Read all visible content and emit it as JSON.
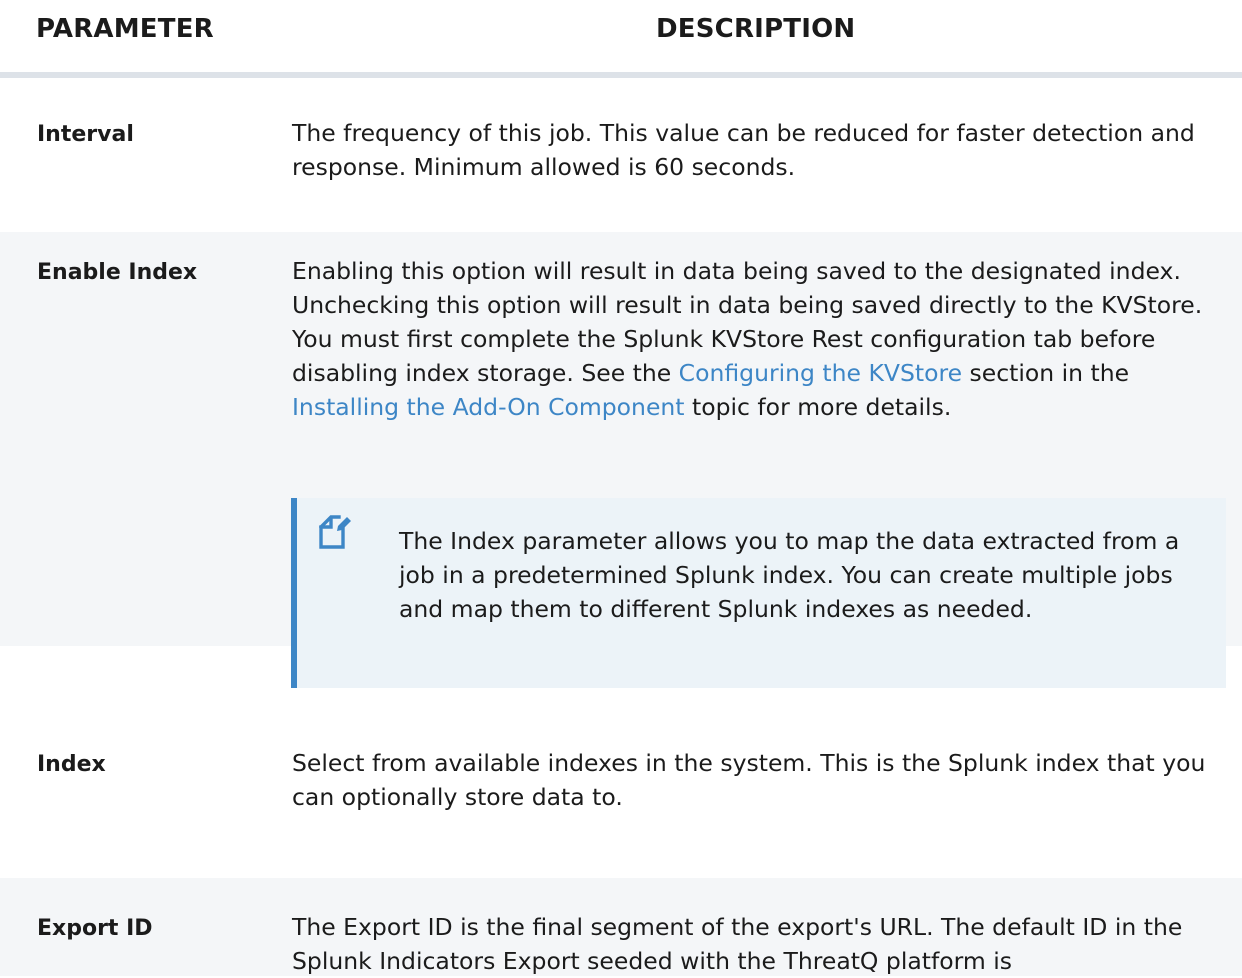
{
  "header": {
    "parameter": "PARAMETER",
    "description": "DESCRIPTION"
  },
  "rows": [
    {
      "param": "Interval",
      "description": "The frequency of this job. This value can be reduced for faster detection and response. Minimum allowed is 60 seconds."
    },
    {
      "param": "Enable Index",
      "desc_1": "Enabling this option will result in data being saved to the designated index. Unchecking this option will result in data being saved directly to the KVStore.  You must first complete the Splunk KVStore Rest configuration tab before disabling index storage. See the ",
      "link_1": "Configuring the KVStore",
      "desc_2": " section in the ",
      "link_2": "Installing the Add-On Component",
      "desc_3": " topic for more details.",
      "note": "The Index parameter allows you to map the data extracted from a job in a predetermined Splunk index. You can create multiple jobs and map them to different Splunk indexes as needed.",
      "note_icon": "note-edit-icon"
    },
    {
      "param": "Index",
      "description": "Select from available indexes in the system.  This is the Splunk index that you can optionally store data to."
    },
    {
      "param": "Export ID",
      "description": "The Export ID is the final segment of the export's URL.   The default ID in the Splunk Indicators Export seeded with the ThreatQ platform is"
    }
  ],
  "colors": {
    "link": "#3d86c6",
    "alt_row": "#f4f6f8",
    "note_bg": "#ecf3f8",
    "note_border": "#3d86c6",
    "header_rule": "#dde2e8"
  }
}
